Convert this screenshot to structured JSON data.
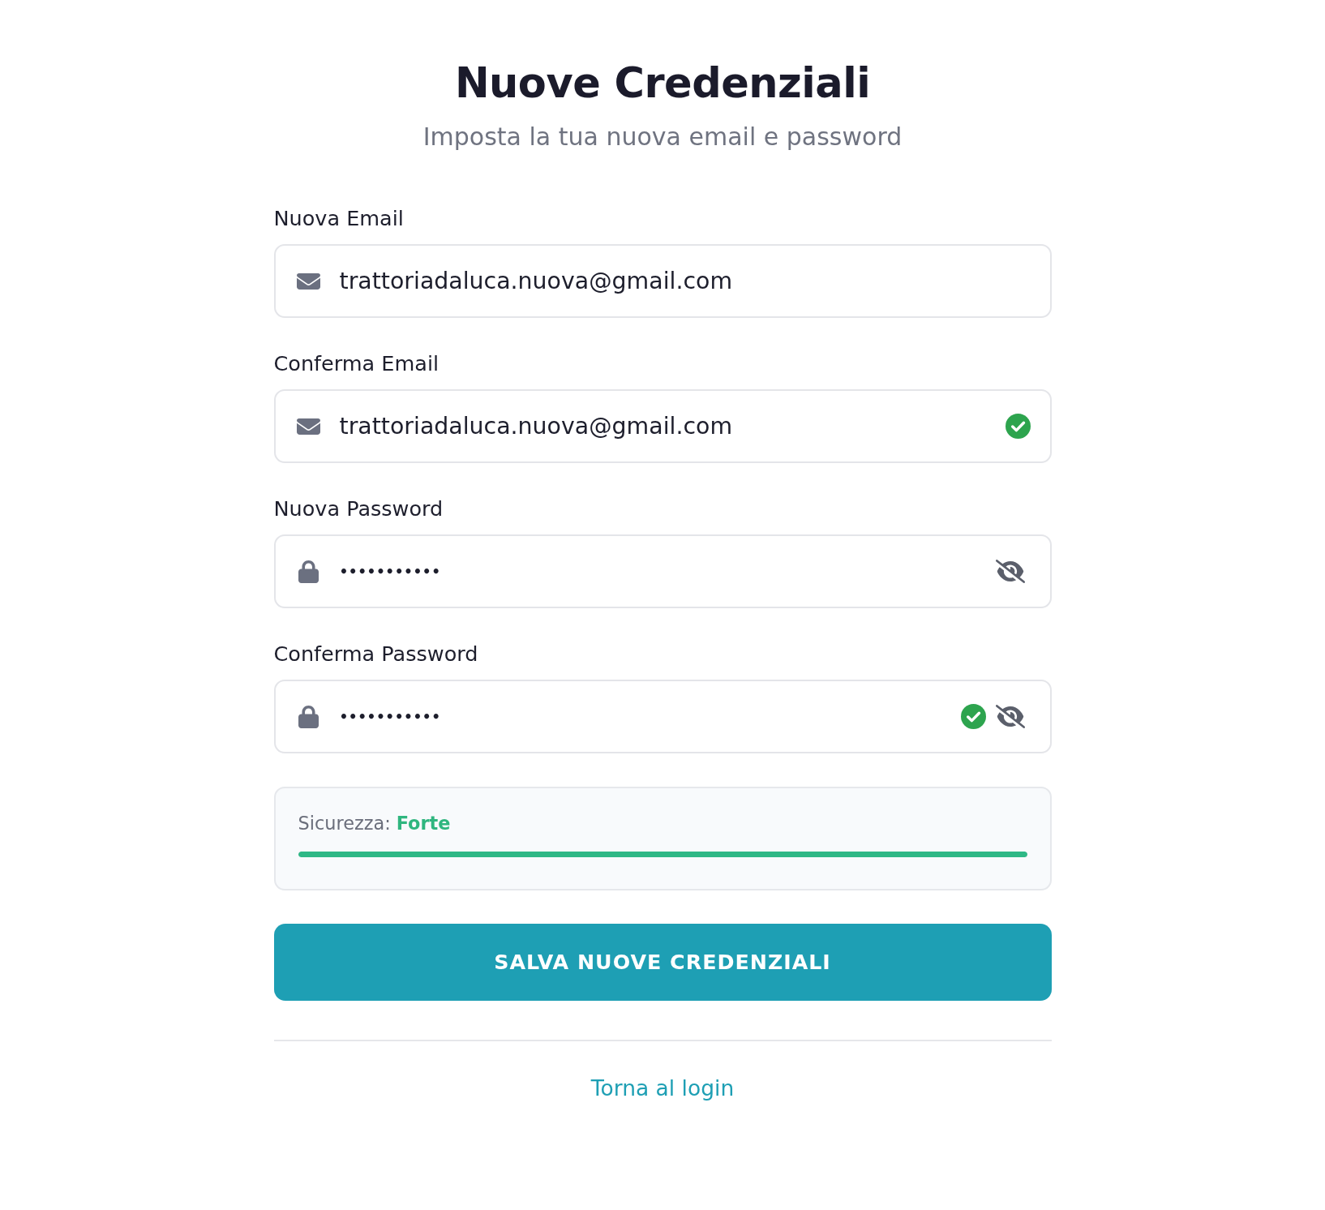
{
  "header": {
    "title": "Nuove Credenziali",
    "subtitle": "Imposta la tua nuova email e password"
  },
  "fields": [
    {
      "label": "Nuova Email",
      "kind": "email",
      "value": "trattoriadaluca.nuova@gmail.com",
      "valid": false
    },
    {
      "label": "Conferma Email",
      "kind": "email",
      "value": "trattoriadaluca.nuova@gmail.com",
      "valid": true
    },
    {
      "label": "Nuova Password",
      "kind": "password",
      "value": "•••••••••••",
      "valid": false,
      "masked": true
    },
    {
      "label": "Conferma Password",
      "kind": "password",
      "value": "•••••••••••",
      "valid": true,
      "masked": true
    }
  ],
  "strength": {
    "label": "Sicurezza:",
    "value": "Forte",
    "level": 1
  },
  "submit_button": {
    "label": "SALVA NUOVE CREDENZIALI"
  },
  "back_link": {
    "label": "Torna al login"
  }
}
